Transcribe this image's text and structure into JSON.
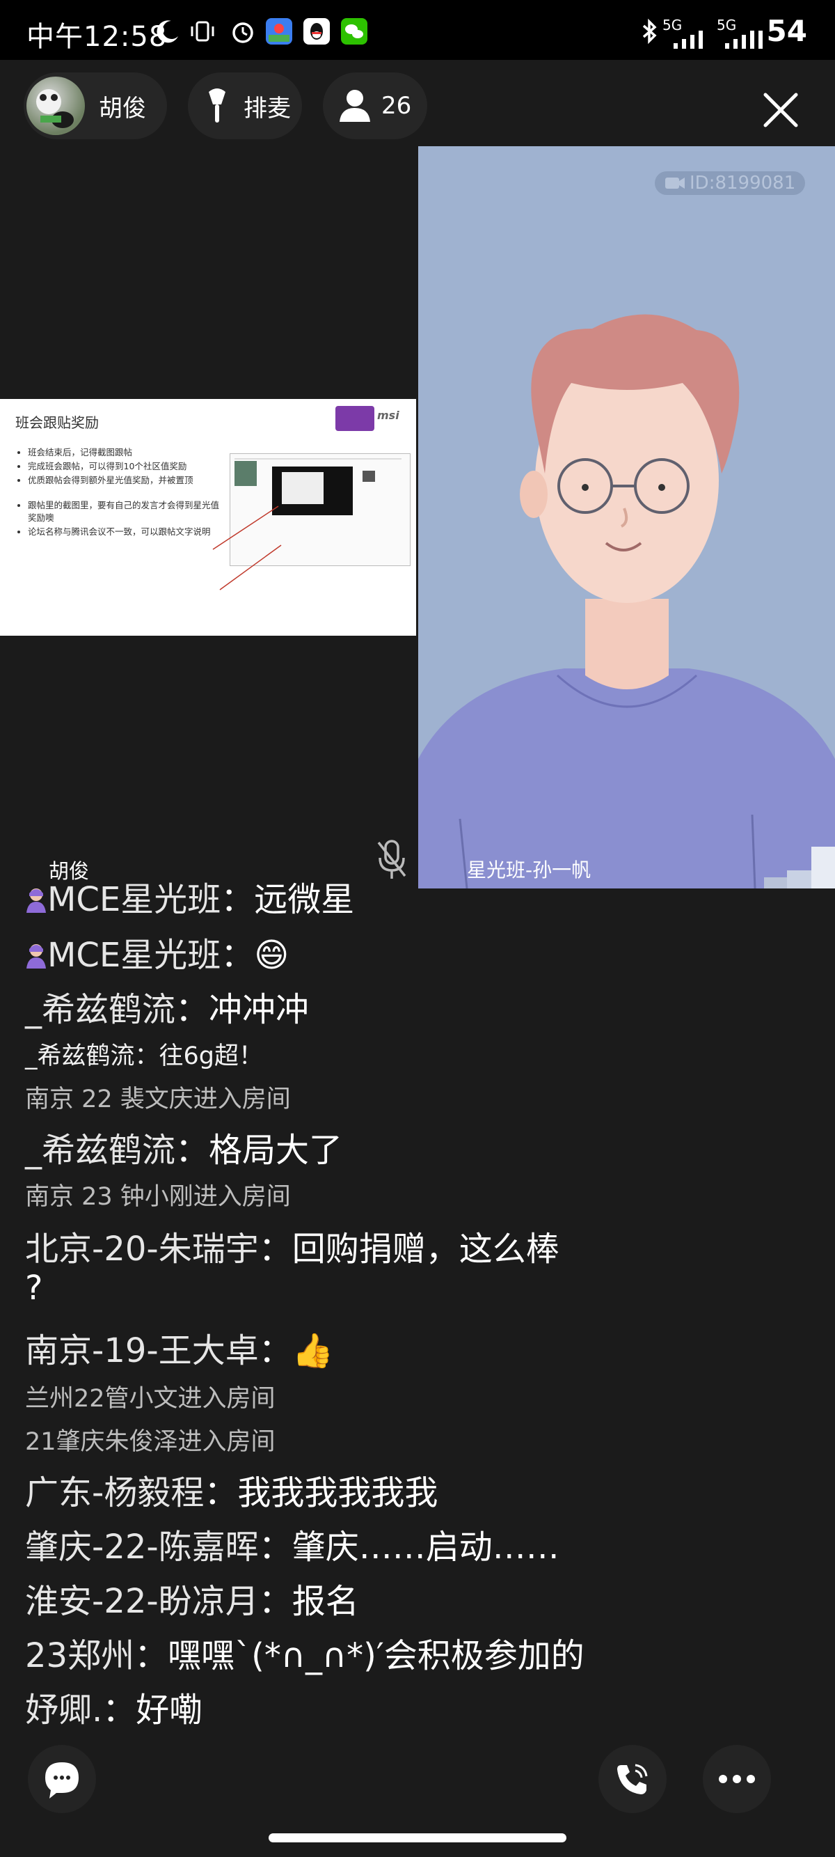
{
  "status_bar": {
    "time": "中午12:58",
    "battery": "54",
    "signal_label_1": "5G",
    "signal_label_2": "5G",
    "icons": [
      "moon-icon",
      "vibrate-icon",
      "alarm-icon",
      "maps-app-icon",
      "qq-app-icon",
      "wechat-app-icon",
      "bluetooth-icon",
      "signal-icon"
    ]
  },
  "top_bar": {
    "host_name": "胡俊",
    "mic_queue_label": "排麦",
    "viewer_count": "26",
    "close_icon": "close-icon"
  },
  "slide": {
    "title": "班会跟贴奖励",
    "brand": "msi",
    "bullets": [
      "班会结束后，记得截图跟帖",
      "完成班会跟帖，可以得到10个社区值奖励",
      "优质跟帖会得到额外星光值奖励，并被置顶",
      "跟帖里的截图里，要有自己的发言才会得到星光值奖励噢",
      "论坛名称与腾讯会议不一致，可以跟帖文字说明"
    ]
  },
  "video": {
    "room_id": "ID:8199081",
    "participant_name": "星光班-孙一帆",
    "host_label": "胡俊"
  },
  "chat": [
    {
      "user": "MCE星光班",
      "text": "远微星",
      "style": "big",
      "admin": true
    },
    {
      "user": "MCE星光班",
      "text": "😄",
      "style": "big",
      "admin": true
    },
    {
      "user": "_希兹鹤流",
      "text": "冲冲冲",
      "style": "big"
    },
    {
      "user": "_希兹鹤流",
      "text": "往6g超！",
      "style": "sm"
    },
    {
      "system": "南京 22 裴文庆进入房间"
    },
    {
      "user": "_希兹鹤流",
      "text": "格局大了",
      "style": "big"
    },
    {
      "system": "南京 23 钟小刚进入房间"
    },
    {
      "user": "北京-20-朱瑞宇",
      "text": "回购捐赠，这么棒",
      "cont": "?",
      "style": "big"
    },
    {
      "user": "南京-19-王大卓",
      "text": "👍",
      "style": "big"
    },
    {
      "system": "兰州22管小文进入房间"
    },
    {
      "system": "21肇庆朱俊泽进入房间"
    },
    {
      "user": "广东-杨毅程",
      "text": "我我我我我我",
      "style": "big"
    },
    {
      "user": "肇庆-22-陈嘉晖",
      "text": "肇庆……启动……",
      "style": "big"
    },
    {
      "user": "淮安-22-盼凉月",
      "text": "报名",
      "style": "big"
    },
    {
      "user": "23郑州",
      "text": "嘿嘿`(*∩_∩*)′会积极参加的",
      "style": "big"
    },
    {
      "user": "妤卿.",
      "text": "好嘞",
      "style": "big"
    }
  ],
  "colors": {
    "background": "#1b1b1b",
    "chip": "#262626",
    "video_bg": "#9fb2d0"
  }
}
